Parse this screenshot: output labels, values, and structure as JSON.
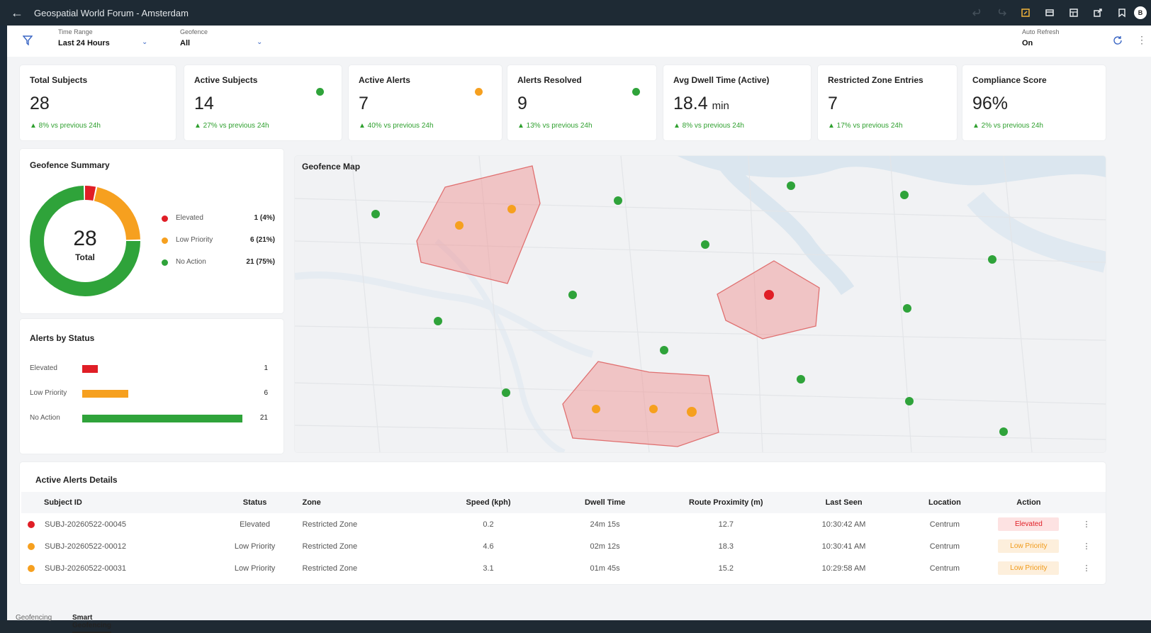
{
  "app": {
    "title": "Geospatial World Forum - Amsterdam",
    "avatar_initial": "B"
  },
  "colors": {
    "red": "#e01e26",
    "orange": "#f6a01f",
    "green": "#2fa33a",
    "accent": "#3a66c4"
  },
  "filters": {
    "time_range": {
      "label": "Time Range",
      "value": "Last 24 Hours"
    },
    "geofence": {
      "label": "Geofence",
      "value": "All"
    },
    "auto_refresh": {
      "label": "Auto Refresh",
      "value": "On"
    }
  },
  "kpis": [
    {
      "label": "Total Subjects",
      "value": "28",
      "unit": "",
      "delta": "▲  8% vs previous 24h",
      "dot": ""
    },
    {
      "label": "Active Subjects",
      "value": "14",
      "unit": "",
      "delta": "▲  27% vs previous 24h",
      "dot": "green"
    },
    {
      "label": "Active Alerts",
      "value": "7",
      "unit": "",
      "delta": "▲  40% vs previous 24h",
      "dot": "orange"
    },
    {
      "label": "Alerts Resolved",
      "value": "9",
      "unit": "",
      "delta": "▲  13% vs previous 24h",
      "dot": "green"
    },
    {
      "label": "Avg Dwell Time (Active)",
      "value": "18.4",
      "unit": "min",
      "delta": "▲  8% vs previous 24h",
      "dot": ""
    },
    {
      "label": "Restricted Zone Entries",
      "value": "7",
      "unit": "",
      "delta": "▲  17% vs previous 24h",
      "dot": ""
    },
    {
      "label": "Compliance Score",
      "value": "96%",
      "unit": "",
      "delta": "▲  2% vs previous 24h",
      "dot": ""
    }
  ],
  "geofence_summary": {
    "title": "Geofence Summary",
    "total": "28",
    "total_label": "Total",
    "legend": [
      {
        "label": "Elevated",
        "value": "1 (4%)",
        "count": 1,
        "color": "#e01e26"
      },
      {
        "label": "Low Priority",
        "value": "6 (21%)",
        "count": 6,
        "color": "#f6a01f"
      },
      {
        "label": "No Action",
        "value": "21 (75%)",
        "count": 21,
        "color": "#2fa33a"
      }
    ]
  },
  "alerts_by_status": {
    "title": "Alerts by Status",
    "rows": [
      {
        "label": "Elevated",
        "value": "1",
        "count": 1,
        "color": "#e01e26"
      },
      {
        "label": "Low Priority",
        "value": "6",
        "count": 6,
        "color": "#f6a01f"
      },
      {
        "label": "No Action",
        "value": "21",
        "count": 21,
        "color": "#2fa33a"
      }
    ]
  },
  "map": {
    "title": "Geofence Map"
  },
  "alerts_table": {
    "title": "Active Alerts Details",
    "columns": [
      "Subject ID",
      "Status",
      "Zone",
      "Speed (kph)",
      "Dwell Time",
      "Route Proximity (m)",
      "Last Seen",
      "Location",
      "Action"
    ],
    "rows": [
      {
        "dot": "#e01e26",
        "id": "SUBJ-20260522-00045",
        "status": "Elevated",
        "zone": "Restricted Zone",
        "speed": "0.2",
        "dwell": "24m 15s",
        "proximity": "12.7",
        "last_seen": "10:30:42 AM",
        "location": "Centrum",
        "action": "Elevated",
        "action_bg": "#fde2e2",
        "action_fg": "#e01e26"
      },
      {
        "dot": "#f6a01f",
        "id": "SUBJ-20260522-00012",
        "status": "Low Priority",
        "zone": "Restricted Zone",
        "speed": "4.6",
        "dwell": "02m 12s",
        "proximity": "18.3",
        "last_seen": "10:30:41 AM",
        "location": "Centrum",
        "action": "Low Priority",
        "action_bg": "#fdefdc",
        "action_fg": "#f09a1a"
      },
      {
        "dot": "#f6a01f",
        "id": "SUBJ-20260522-00031",
        "status": "Low Priority",
        "zone": "Restricted Zone",
        "speed": "3.1",
        "dwell": "01m 45s",
        "proximity": "15.2",
        "last_seen": "10:29:58 AM",
        "location": "Centrum",
        "action": "Low Priority",
        "action_bg": "#fdefdc",
        "action_fg": "#f09a1a"
      }
    ]
  },
  "tabs": [
    "Geofencing",
    "Smart Geofencing"
  ]
}
